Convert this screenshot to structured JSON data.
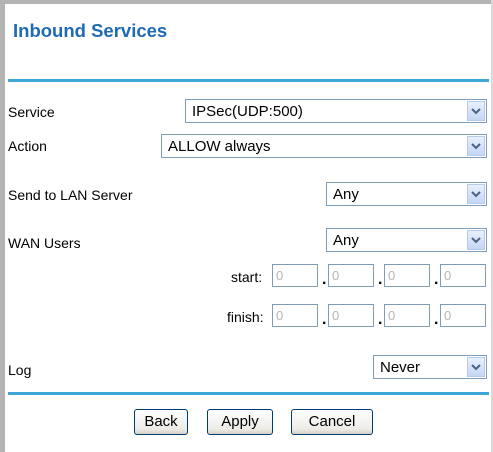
{
  "title": "Inbound Services",
  "fields": {
    "service": {
      "label": "Service",
      "value": "IPSec(UDP:500)"
    },
    "action": {
      "label": "Action",
      "value": "ALLOW always"
    },
    "send_to_lan": {
      "label": "Send to LAN Server",
      "value": "Any"
    },
    "wan_users": {
      "label": "WAN Users",
      "value": "Any"
    },
    "start": {
      "label": "start:",
      "octets": [
        "0",
        "0",
        "0",
        "0"
      ]
    },
    "finish": {
      "label": "finish:",
      "octets": [
        "0",
        "0",
        "0",
        "0"
      ]
    },
    "log": {
      "label": "Log",
      "value": "Never"
    }
  },
  "ip_separator": ".",
  "buttons": {
    "back": "Back",
    "apply": "Apply",
    "cancel": "Cancel"
  },
  "colors": {
    "title": "#1f6bb3",
    "rule": "#3fa7d8",
    "select_border": "#7f9db9"
  },
  "icons": {
    "dropdown": "chevron-down-icon"
  }
}
